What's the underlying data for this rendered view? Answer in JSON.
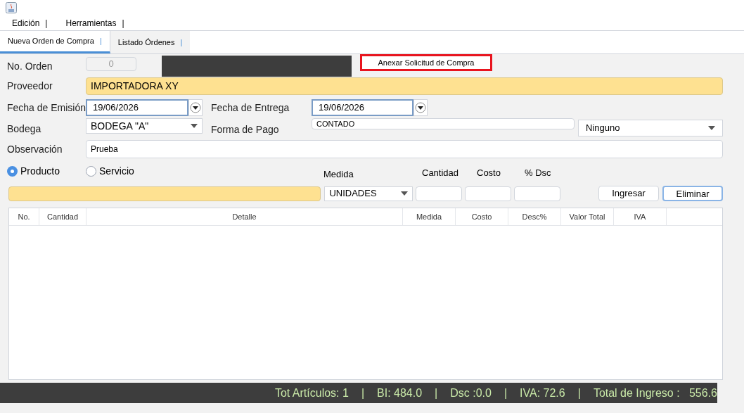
{
  "menu": {
    "separator": "|",
    "items": [
      "Edición",
      "Herramientas"
    ]
  },
  "tabs": {
    "separator": "|",
    "items": [
      {
        "label": "Nueva Orden de Compra",
        "selected": true
      },
      {
        "label": "Listado Órdenes",
        "selected": false
      }
    ]
  },
  "form": {
    "order_label": "No. Orden",
    "order_value": "0",
    "attach_button": "Anexar Solicitud de Compra",
    "supplier_label": "Proveedor",
    "supplier_value": "IMPORTADORA XY",
    "issue_label": "Fecha de Emisión",
    "issue_value": "19/06/2026",
    "delivery_label": "Fecha de Entrega",
    "delivery_value": "19/06/2026",
    "warehouse_label": "Bodega",
    "warehouse_value": "BODEGA \"A\"",
    "payment_label": "Forma de Pago",
    "payment_value": "CONTADO",
    "payment_option": "Ninguno",
    "note_label": "Observación",
    "note_value": "Prueba"
  },
  "item_type": [
    {
      "label": "Producto",
      "selected": true
    },
    {
      "label": "Servicio",
      "selected": false
    }
  ],
  "entry": {
    "unit_label": "Medida",
    "unit_value": "UNIDADES",
    "qty_label": "Cantidad",
    "cost_label": "Costo",
    "discount_label": "% Dsc"
  },
  "buttons": [
    "Ingresar",
    "Eliminar"
  ],
  "table": {
    "columns": [
      "No.",
      "Cantidad",
      "Detalle",
      "Medida",
      "Costo",
      "Desc%",
      "Valor Total",
      "IVA"
    ]
  },
  "status_bar": {
    "separator": "|",
    "items": [
      "Tot Artículos: 1",
      "BI: 484.0",
      "Dsc :0.0",
      "IVA: 72.6",
      "Total de Ingreso :   556.6"
    ]
  }
}
